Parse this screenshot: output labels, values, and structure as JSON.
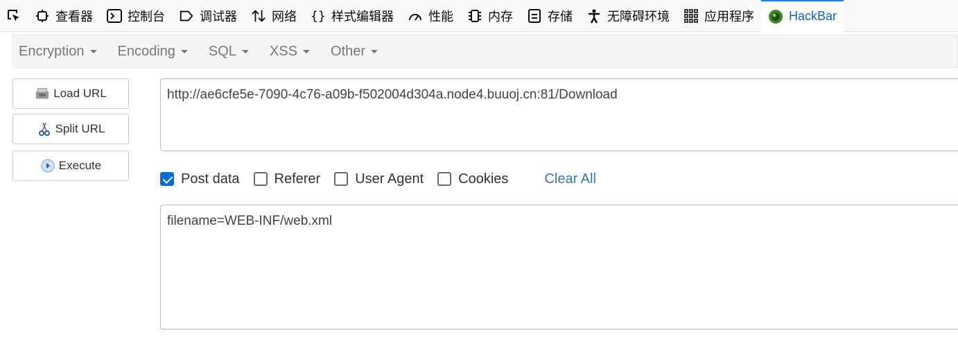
{
  "devtools": {
    "tabs": [
      {
        "label": "查看器",
        "icon": "inspector-icon"
      },
      {
        "label": "控制台",
        "icon": "console-icon"
      },
      {
        "label": "调试器",
        "icon": "debugger-icon"
      },
      {
        "label": "网络",
        "icon": "network-icon"
      },
      {
        "label": "样式编辑器",
        "icon": "style-editor-icon"
      },
      {
        "label": "性能",
        "icon": "performance-icon"
      },
      {
        "label": "内存",
        "icon": "memory-icon"
      },
      {
        "label": "存储",
        "icon": "storage-icon"
      },
      {
        "label": "无障碍环境",
        "icon": "accessibility-icon"
      },
      {
        "label": "应用程序",
        "icon": "application-icon"
      },
      {
        "label": "HackBar",
        "icon": "hackbar-icon"
      }
    ],
    "active_tab": "HackBar",
    "accent_color": "#0a84ff"
  },
  "hackbar": {
    "menu": [
      "Encryption",
      "Encoding",
      "SQL",
      "XSS",
      "Other"
    ],
    "buttons": {
      "load_url": "Load URL",
      "split_url": "Split URL",
      "execute": "Execute"
    },
    "url": "http://ae6cfe5e-7090-4c76-a09b-f502004d304a.node4.buuoj.cn:81/Download",
    "options": {
      "post_data": {
        "label": "Post data",
        "checked": true
      },
      "referer": {
        "label": "Referer",
        "checked": false
      },
      "user_agent": {
        "label": "User Agent",
        "checked": false
      },
      "cookies": {
        "label": "Cookies",
        "checked": false
      }
    },
    "clear_all": "Clear All",
    "post_body": "filename=WEB-INF/web.xml"
  }
}
